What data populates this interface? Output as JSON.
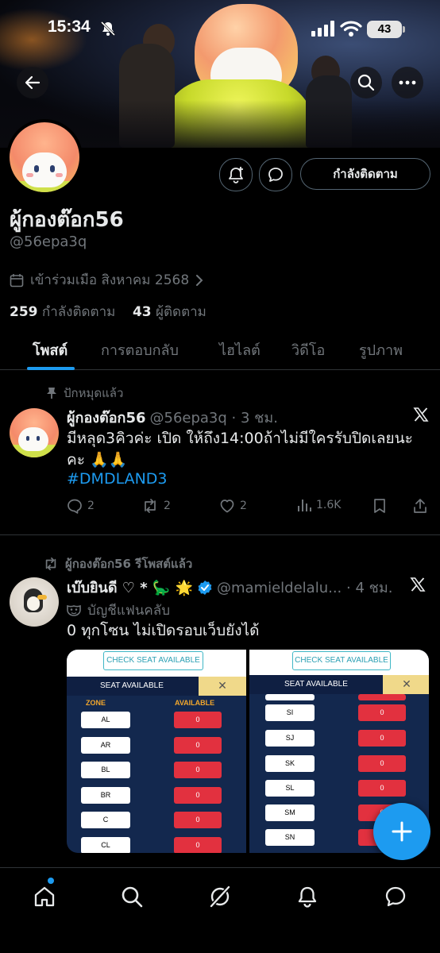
{
  "status_bar": {
    "time": "15:34",
    "battery": "43"
  },
  "profile": {
    "display_name": "ผู้กองต๊อก56",
    "handle": "@56epa3q",
    "joined": "เข้าร่วมเมือ สิงหาคม 2568",
    "following_count": "259",
    "following_label": "กำลังติดตาม",
    "followers_count": "43",
    "followers_label": "ผู้ติดตาม",
    "follow_button": "กำลังติดตาม"
  },
  "tabs": [
    "โพสต์",
    "การตอบกลับ",
    "ไฮไลต์",
    "วิดีโอ",
    "รูปภาพ"
  ],
  "post1": {
    "context": "ปักหมุดแล้ว",
    "name": "ผู้กองต๊อก56",
    "handle_time": "@56epa3q · 3 ชม.",
    "text_line1": "มีหลุด3คิวค่ะ เปิด ให้ถึง14:00ถ้าไม่มีใครรับปิดเลยนะ",
    "text_line2": "คะ 🙏🙏",
    "hashtag": "#DMDLAND3",
    "replies": "2",
    "reposts": "2",
    "likes": "2",
    "views": "1.6K"
  },
  "post2": {
    "context": "ผู้กองต๊อก56 รีโพสต์แล้ว",
    "name": "เบ๊บยินดี ♡ * 🦕 🌟",
    "handle_time": "@mamieldelalu... · 4 ชม.",
    "fan_label": "บัญชีแฟนคลับ",
    "text": "0 ทุกโซน ไม่เปิดรอบเว็บยังได้"
  },
  "seat_left": {
    "check": "CHECK SEAT AVAILABLE",
    "title": "SEAT AVAILABLE",
    "zone_header": "ZONE",
    "available_header": "AVAILABLE",
    "rows": [
      {
        "zone": "AL",
        "value": "0"
      },
      {
        "zone": "AR",
        "value": "0"
      },
      {
        "zone": "BL",
        "value": "0"
      },
      {
        "zone": "BR",
        "value": "0"
      },
      {
        "zone": "C",
        "value": "0"
      },
      {
        "zone": "CL",
        "value": "0"
      }
    ]
  },
  "seat_right": {
    "check": "CHECK SEAT AVAILABLE",
    "title": "SEAT AVAILABLE",
    "rows": [
      {
        "zone": "SI",
        "value": "0"
      },
      {
        "zone": "SJ",
        "value": "0"
      },
      {
        "zone": "SK",
        "value": "0"
      },
      {
        "zone": "SL",
        "value": "0"
      },
      {
        "zone": "SM",
        "value": "0"
      },
      {
        "zone": "SN",
        "value": "0"
      }
    ]
  },
  "colors": {
    "accent": "#1d9bf0",
    "muted": "#71767b",
    "text": "#e7e9ea",
    "divider": "#2f3336",
    "seat_red": "#e2313f"
  },
  "icons": [
    "back-arrow-icon",
    "search-icon",
    "more-icon",
    "notify-add-icon",
    "message-icon",
    "calendar-icon",
    "pin-icon",
    "x-logo-icon",
    "reply-icon",
    "repost-icon",
    "like-icon",
    "views-icon",
    "bookmark-icon",
    "share-icon",
    "verified-icon",
    "fan-mask-icon",
    "plus-icon",
    "home-icon",
    "grok-icon",
    "bell-icon",
    "chat-icon"
  ]
}
